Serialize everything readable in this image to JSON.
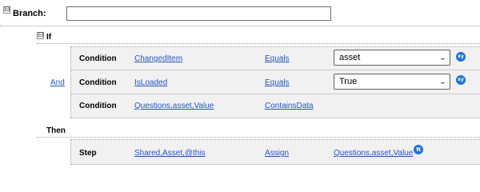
{
  "branch": {
    "label": "Branch:",
    "value": ""
  },
  "if_label": "If",
  "then_label": "Then",
  "joiner": "And",
  "conditions": [
    {
      "kind": "Condition",
      "field": "ChangedItem",
      "operator": "Equals",
      "value": "asset",
      "badge": "xy"
    },
    {
      "kind": "Condition",
      "field": "IsLoaded",
      "operator": "Equals",
      "value": "True",
      "badge": "xy"
    },
    {
      "kind": "Condition",
      "field": "Questions,asset,Value",
      "operator": "ContainsData"
    }
  ],
  "step": {
    "kind": "Step",
    "target": "Shared,Asset,@this",
    "action": "Assign",
    "value": "Questions,asset,Value",
    "badge": "π"
  },
  "icons": {
    "collapse": "⊟",
    "dropdown": "⌄"
  },
  "colors": {
    "link": "#2255cc",
    "badge": "#1f73d8",
    "panel": "#f1f1f1"
  }
}
